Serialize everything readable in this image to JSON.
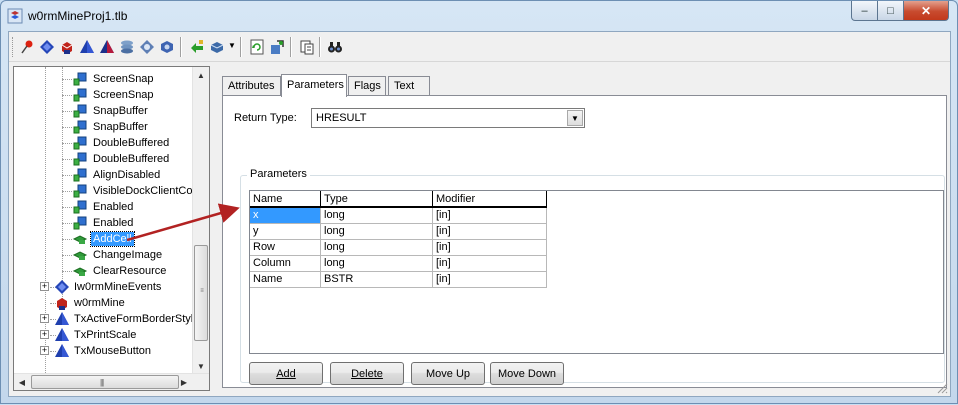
{
  "window": {
    "title": "w0rmMineProj1.tlb"
  },
  "caption": {
    "min": "–",
    "max": "□",
    "close": "✕"
  },
  "toolbar": {
    "buttons": [
      "pin-icon",
      "blue-diamond-icon",
      "red-cube-icon",
      "blue-pyramid-icon",
      "shaded-pyramid-icon",
      "stack-icon",
      "gear-diamond-icon",
      "cube-gear-icon",
      "green-arrow-icon",
      "cube-drop-icon",
      "refresh-icon",
      "build-icon",
      "copy-icon",
      "binoculars-icon"
    ]
  },
  "tree": {
    "items": [
      {
        "label": "ScreenSnap",
        "icon": "property-icon"
      },
      {
        "label": "ScreenSnap",
        "icon": "property-icon"
      },
      {
        "label": "SnapBuffer",
        "icon": "property-icon"
      },
      {
        "label": "SnapBuffer",
        "icon": "property-icon"
      },
      {
        "label": "DoubleBuffered",
        "icon": "property-icon"
      },
      {
        "label": "DoubleBuffered",
        "icon": "property-icon"
      },
      {
        "label": "AlignDisabled",
        "icon": "property-icon"
      },
      {
        "label": "VisibleDockClientCou",
        "icon": "property-icon"
      },
      {
        "label": "Enabled",
        "icon": "property-icon"
      },
      {
        "label": "Enabled",
        "icon": "property-icon"
      },
      {
        "label": "AddCell",
        "icon": "method-icon",
        "selected": true
      },
      {
        "label": "ChangeImage",
        "icon": "method-icon"
      },
      {
        "label": "ClearResource",
        "icon": "method-icon"
      }
    ],
    "root_items": [
      {
        "label": "Iw0rmMineEvents",
        "icon": "interface-icon",
        "expander": "+"
      },
      {
        "label": "w0rmMine",
        "icon": "coclass-icon",
        "expander": ""
      },
      {
        "label": "TxActiveFormBorderStyle",
        "icon": "enum-icon",
        "expander": "+"
      },
      {
        "label": "TxPrintScale",
        "icon": "enum-icon",
        "expander": "+"
      },
      {
        "label": "TxMouseButton",
        "icon": "enum-icon",
        "expander": "+"
      }
    ]
  },
  "tabs": [
    {
      "label": "Attributes"
    },
    {
      "label": "Parameters",
      "active": true
    },
    {
      "label": "Flags"
    },
    {
      "label": "Text"
    }
  ],
  "return_type": {
    "label": "Return Type:",
    "value": "HRESULT"
  },
  "parameters": {
    "group_title": "Parameters",
    "columns": [
      "Name",
      "Type",
      "Modifier"
    ],
    "rows": [
      [
        "x",
        "long",
        "[in]"
      ],
      [
        "y",
        "long",
        "[in]"
      ],
      [
        "Row",
        "long",
        "[in]"
      ],
      [
        "Column",
        "long",
        "[in]"
      ],
      [
        "Name",
        "BSTR",
        "[in]"
      ]
    ]
  },
  "buttons": {
    "add": "Add",
    "delete": "Delete",
    "move_up": "Move Up",
    "move_down": "Move Down"
  },
  "scroll": {
    "grip": "≡",
    "hgrip": "|||"
  },
  "colors": {
    "selection": "#3399ff",
    "arrow": "#b22222"
  }
}
